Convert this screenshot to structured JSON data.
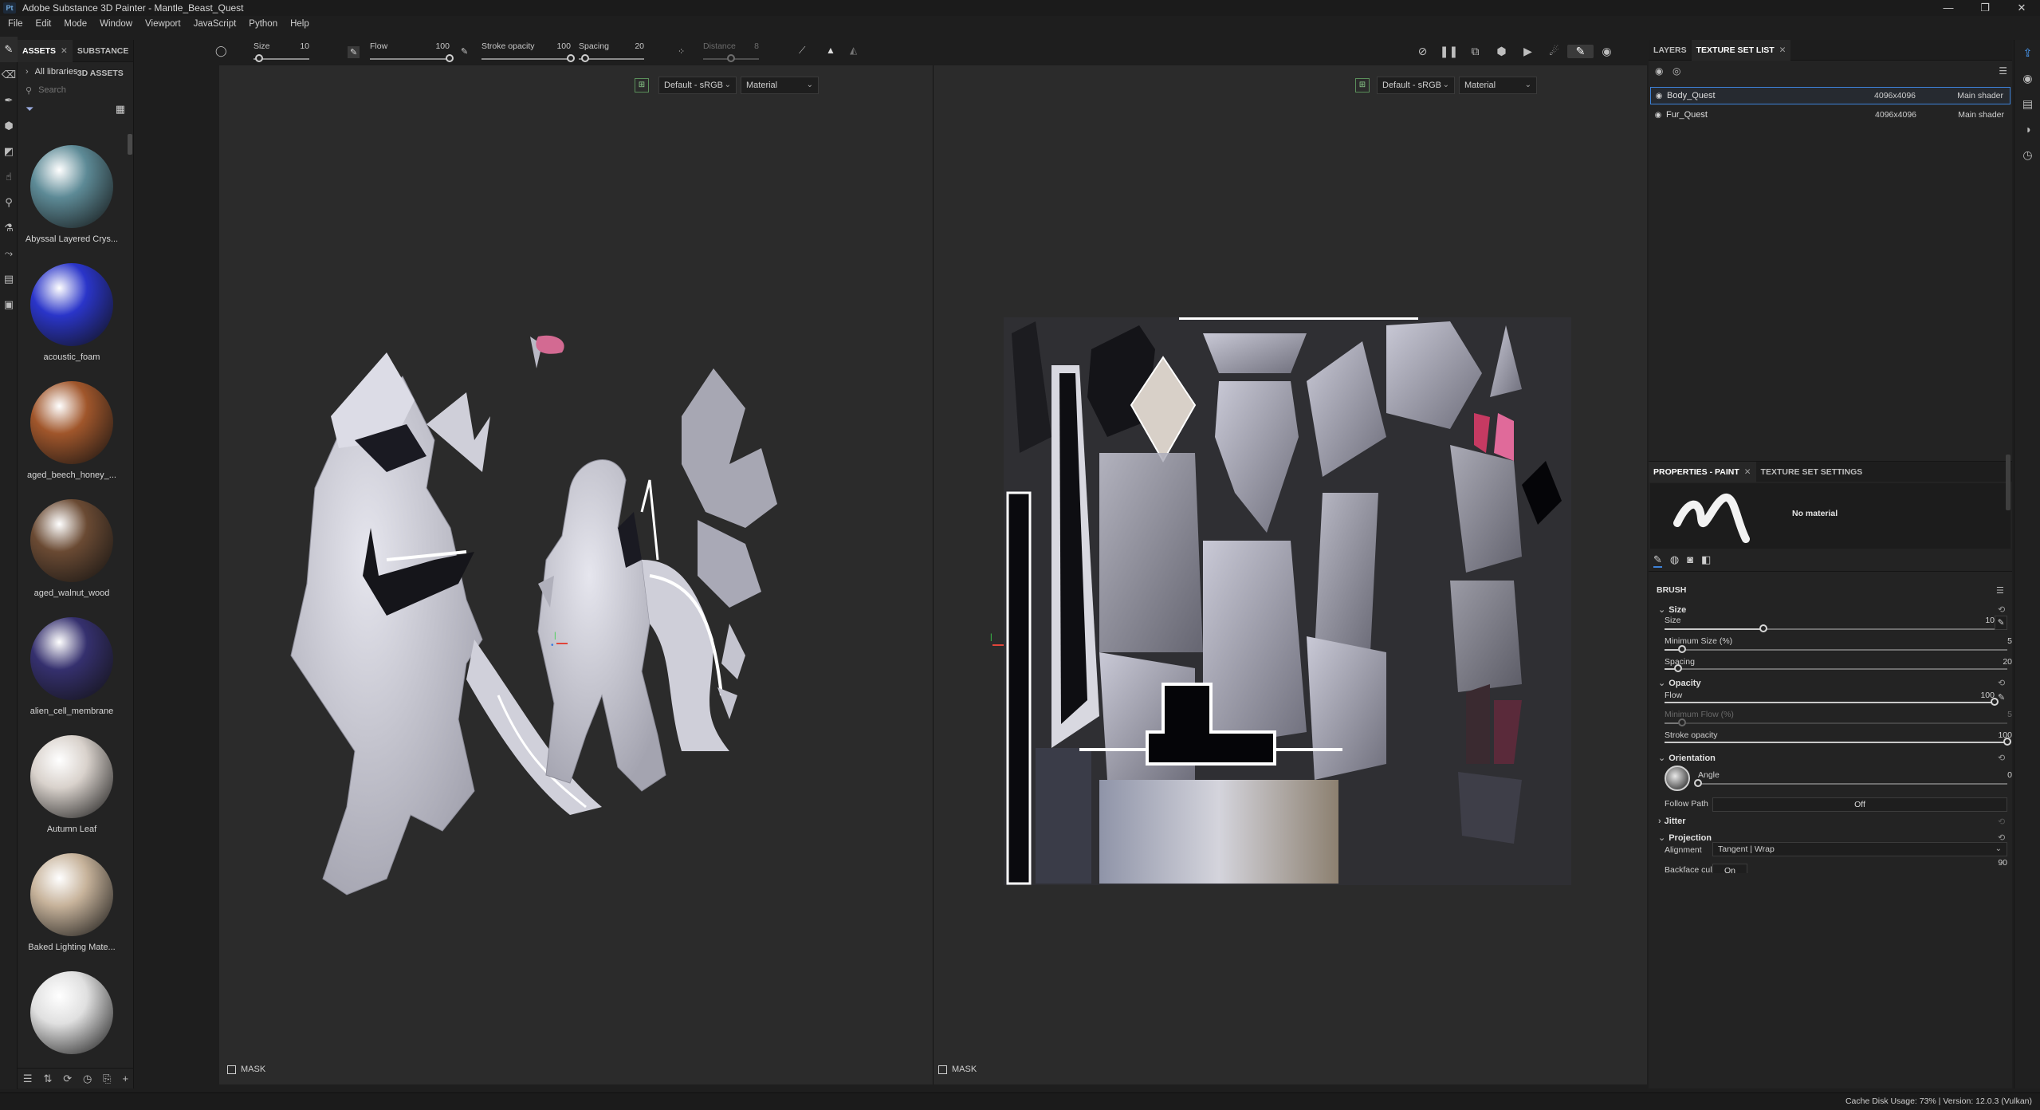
{
  "app": {
    "title": "Adobe Substance 3D Painter - Mantle_Beast_Quest",
    "logo_text": "Pt",
    "window_controls": [
      "—",
      "❐",
      "✕"
    ]
  },
  "menu": [
    "File",
    "Edit",
    "Mode",
    "Window",
    "Viewport",
    "JavaScript",
    "Python",
    "Help"
  ],
  "assets_panel": {
    "tabs": [
      {
        "label": "ASSETS",
        "active": true,
        "closable": true
      },
      {
        "label": "SUBSTANCE 3D ASSETS",
        "active": false,
        "closable": false
      }
    ],
    "library": "All libraries",
    "search_placeholder": "Search",
    "items": [
      {
        "name": "Abyssal Layered Crys...",
        "color": "#5d8a96"
      },
      {
        "name": "acoustic_foam",
        "color": "#2a35c9"
      },
      {
        "name": "aged_beech_honey_...",
        "color": "#a0562b"
      },
      {
        "name": "aged_walnut_wood",
        "color": "#6a4a33"
      },
      {
        "name": "alien_cell_membrane",
        "color": "#35306e"
      },
      {
        "name": "Autumn Leaf",
        "color": "#d9d2cc"
      },
      {
        "name": "Baked Lighting Mate...",
        "color": "#c7b39b"
      },
      {
        "name": "",
        "color": "#e0e0e0"
      }
    ]
  },
  "tool_properties": {
    "size": {
      "label": "Size",
      "value": "10",
      "fraction": 0.1
    },
    "flow": {
      "label": "Flow",
      "value": "100",
      "fraction": 1.0
    },
    "stroke_opacity": {
      "label": "Stroke opacity",
      "value": "100",
      "fraction": 1.0
    },
    "spacing": {
      "label": "Spacing",
      "value": "20",
      "fraction": 0.1
    },
    "distance": {
      "label": "Distance",
      "value": "8",
      "fraction": 0.5
    }
  },
  "viewport_icons": [
    "no-symmetry-icon",
    "pause-icon",
    "split-view-icon",
    "render-mode-icon",
    "camera-icon",
    "lighting-icon",
    "brush-mode-icon",
    "screenshot-icon"
  ],
  "viewport_3d": {
    "colorspace": "Default - sRGB",
    "channel": "Material",
    "mask_label": "MASK"
  },
  "viewport_2d": {
    "colorspace": "Default - sRGB",
    "channel": "Material",
    "mask_label": "MASK"
  },
  "layers_panel": {
    "tabs": [
      {
        "label": "LAYERS",
        "active": false,
        "closable": false
      },
      {
        "label": "TEXTURE SET LIST",
        "active": true,
        "closable": true
      }
    ],
    "texture_sets": [
      {
        "name": "Body_Quest",
        "resolution": "4096x4096",
        "shader": "Main shader",
        "selected": true
      },
      {
        "name": "Fur_Quest",
        "resolution": "4096x4096",
        "shader": "Main shader",
        "selected": false
      }
    ]
  },
  "properties_panel": {
    "tabs": [
      {
        "label": "PROPERTIES - PAINT",
        "active": true,
        "closable": true
      },
      {
        "label": "TEXTURE SET SETTINGS",
        "active": false,
        "closable": false
      }
    ],
    "material_label": "No material",
    "brush_heading": "BRUSH",
    "size_section": {
      "title": "Size",
      "size": {
        "label": "Size",
        "value": "10",
        "fraction": 0.3
      },
      "minimum_size": {
        "label": "Minimum Size (%)",
        "value": "5",
        "fraction": 0.05
      },
      "spacing": {
        "label": "Spacing",
        "value": "20",
        "fraction": 0.04
      }
    },
    "opacity_section": {
      "title": "Opacity",
      "flow": {
        "label": "Flow",
        "value": "100",
        "fraction": 1.0
      },
      "minimum_flow": {
        "label": "Minimum Flow (%)",
        "value": "5",
        "fraction": 0.05
      },
      "stroke_opacity": {
        "label": "Stroke opacity",
        "value": "100",
        "fraction": 1.0
      }
    },
    "orientation_section": {
      "title": "Orientation",
      "angle": {
        "label": "Angle",
        "value": "0",
        "fraction": 0.0
      },
      "follow_path": {
        "label": "Follow Path",
        "value": "Off"
      }
    },
    "jitter_section": {
      "title": "Jitter"
    },
    "projection_section": {
      "title": "Projection",
      "alignment": {
        "label": "Alignment",
        "value": "Tangent | Wrap"
      },
      "backface_culling": {
        "label": "Backface culling",
        "value": "On",
        "angle_value": "90"
      }
    }
  },
  "status_bar": {
    "text": "Cache Disk Usage:   73% | Version: 12.0.3 (Vulkan)"
  },
  "colors": {
    "accent": "#3d82d8",
    "panel_bg": "#232323",
    "viewport_bg": "#2b2b2b"
  }
}
